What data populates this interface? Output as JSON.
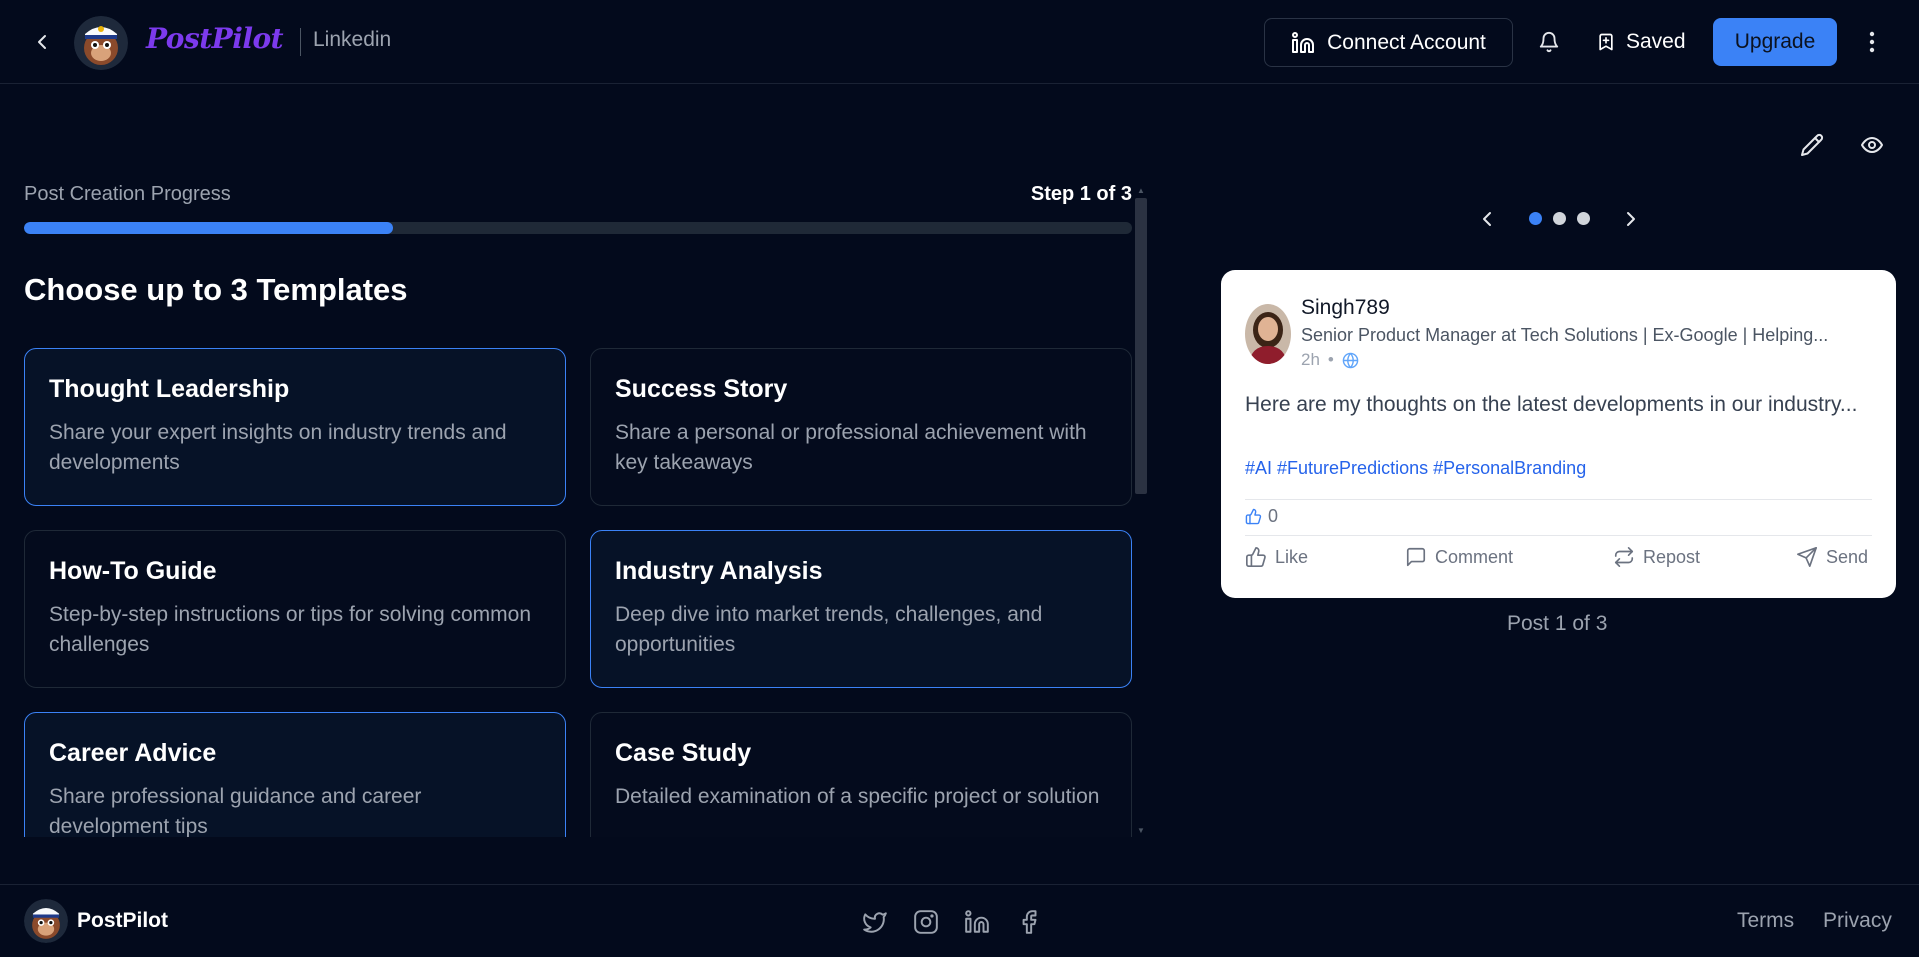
{
  "header": {
    "brand": "PostPilot",
    "platform": "Linkedin",
    "connect_label": "Connect Account",
    "saved_label": "Saved",
    "upgrade_label": "Upgrade"
  },
  "progress": {
    "label": "Post Creation Progress",
    "step_text": "Step 1 of 3",
    "fraction": 0.333
  },
  "section_title": "Choose up to 3 Templates",
  "templates": [
    {
      "title": "Thought Leadership",
      "description": "Share your expert insights on industry trends and developments",
      "selected": true
    },
    {
      "title": "Success Story",
      "description": "Share a personal or professional achievement with key takeaways",
      "selected": false
    },
    {
      "title": "How-To Guide",
      "description": "Step-by-step instructions or tips for solving common challenges",
      "selected": false
    },
    {
      "title": "Industry Analysis",
      "description": "Deep dive into market trends, challenges, and opportunities",
      "selected": true
    },
    {
      "title": "Career Advice",
      "description": "Share professional guidance and career development tips",
      "selected": true
    },
    {
      "title": "Case Study",
      "description": "Detailed examination of a specific project or solution",
      "selected": false
    }
  ],
  "preview": {
    "active_dot": 0,
    "dots": 3,
    "post": {
      "user": "Singh789",
      "headline": "Senior Product Manager at Tech Solutions | Ex-Google | Helping...",
      "time": "2h",
      "meta_sep": "•",
      "body": "Here are my thoughts on the latest developments in our industry...",
      "tags": "#AI #FuturePredictions #PersonalBranding",
      "reactions": "0",
      "actions": {
        "like": "Like",
        "comment": "Comment",
        "repost": "Repost",
        "send": "Send"
      }
    },
    "counter": "Post 1 of 3"
  },
  "footer": {
    "brand": "PostPilot",
    "terms": "Terms",
    "privacy": "Privacy"
  },
  "colors": {
    "background": "#030a1c",
    "accent": "#3b82f6",
    "brand": "#7c3aed"
  }
}
